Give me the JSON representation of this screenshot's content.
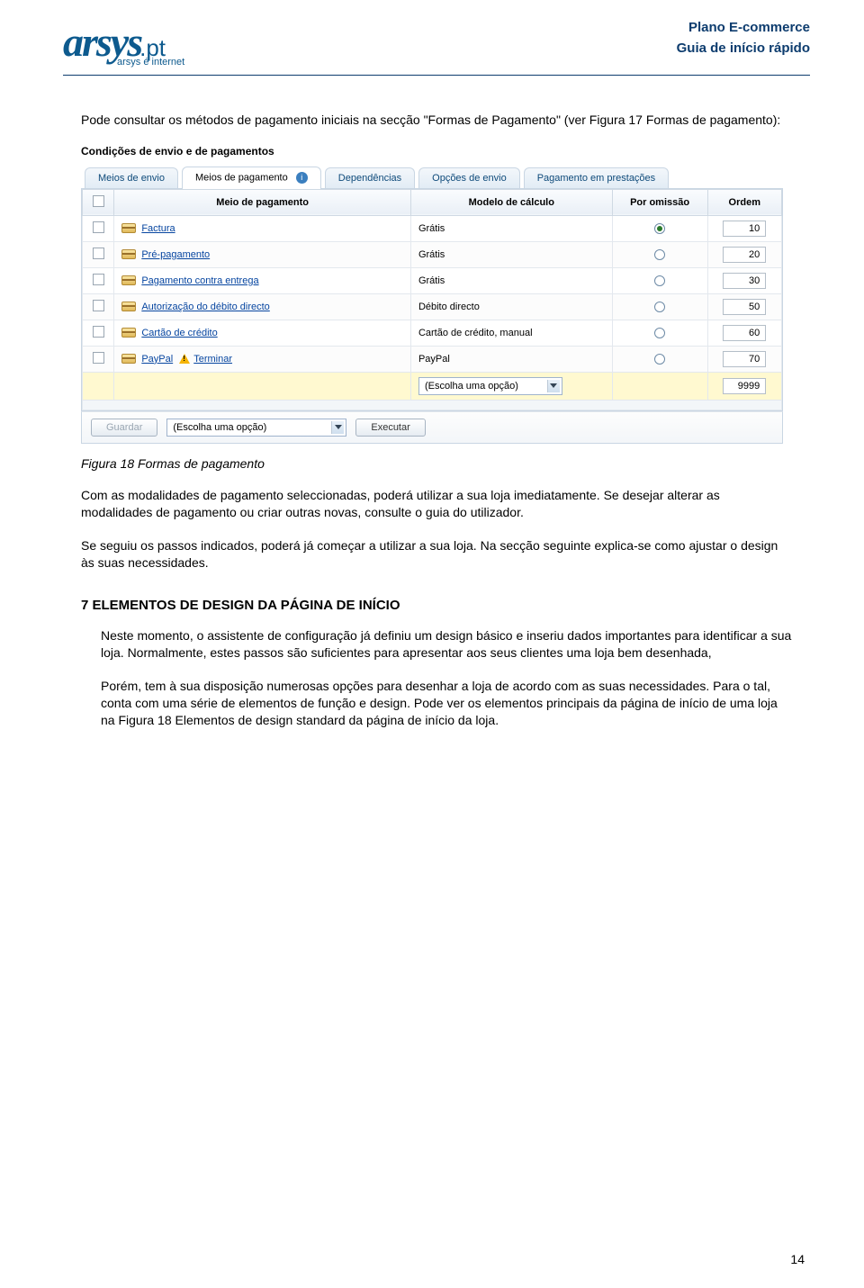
{
  "header": {
    "logo_main": "arsys",
    "logo_suffix": ".pt",
    "logo_tagline": "arsys é internet",
    "line1": "Plano E-commerce",
    "line2": "Guia de início rápido"
  },
  "intro": "Pode consultar os métodos de pagamento iniciais na secção \"Formas de Pagamento\" (ver Figura 17 Formas de pagamento):",
  "figure": {
    "panel_title": "Condições de envio e de pagamentos",
    "tabs": [
      {
        "label": "Meios de envio",
        "active": false
      },
      {
        "label": "Meios de pagamento",
        "active": true,
        "info": true
      },
      {
        "label": "Dependências",
        "active": false
      },
      {
        "label": "Opções de envio",
        "active": false
      },
      {
        "label": "Pagamento em prestações",
        "active": false
      }
    ],
    "columns": {
      "chk": "",
      "meio": "Meio de pagamento",
      "modelo": "Modelo de cálculo",
      "por_omissao": "Por omissão",
      "ordem": "Ordem"
    },
    "rows": [
      {
        "name": "Factura",
        "modelo": "Grátis",
        "selected": true,
        "ordem": "10",
        "warn": false
      },
      {
        "name": "Pré-pagamento",
        "modelo": "Grátis",
        "selected": false,
        "ordem": "20",
        "warn": false
      },
      {
        "name": "Pagamento contra entrega",
        "modelo": "Grátis",
        "selected": false,
        "ordem": "30",
        "warn": false
      },
      {
        "name": "Autorização do débito directo",
        "modelo": "Débito directo",
        "selected": false,
        "ordem": "50",
        "warn": false
      },
      {
        "name": "Cartão de crédito",
        "modelo": "Cartão de crédito, manual",
        "selected": false,
        "ordem": "60",
        "warn": false
      },
      {
        "name": "PayPal",
        "modelo": "PayPal",
        "selected": false,
        "ordem": "70",
        "warn": true,
        "warn_label": "Terminar"
      }
    ],
    "add_row": {
      "select_placeholder": "(Escolha uma opção)",
      "ordem": "9999"
    },
    "footer": {
      "save": "Guardar",
      "select_placeholder": "(Escolha uma opção)",
      "execute": "Executar"
    },
    "caption": "Figura 18 Formas de pagamento"
  },
  "after_fig": {
    "p1": "Com as modalidades de pagamento seleccionadas, poderá utilizar a sua loja imediatamente. Se desejar alterar as modalidades de pagamento ou criar outras novas, consulte o guia do utilizador.",
    "p2": "Se seguiu os passos indicados, poderá já começar a utilizar a sua loja. Na secção seguinte explica-se como ajustar o design às suas necessidades."
  },
  "section": {
    "title": "7 ELEMENTOS DE DESIGN DA PÁGINA DE INÍCIO",
    "p1": "Neste momento, o assistente de configuração já definiu um design básico e inseriu dados importantes para identificar a sua loja. Normalmente, estes passos são suficientes para apresentar aos seus clientes uma loja bem desenhada,",
    "p2": "Porém, tem à sua disposição numerosas opções para desenhar a loja de acordo com as suas necessidades. Para o tal, conta com uma série de elementos de função e design. Pode ver os elementos principais da página de início de uma loja na Figura 18 Elementos de design standard da página de início da loja."
  },
  "page_number": "14"
}
